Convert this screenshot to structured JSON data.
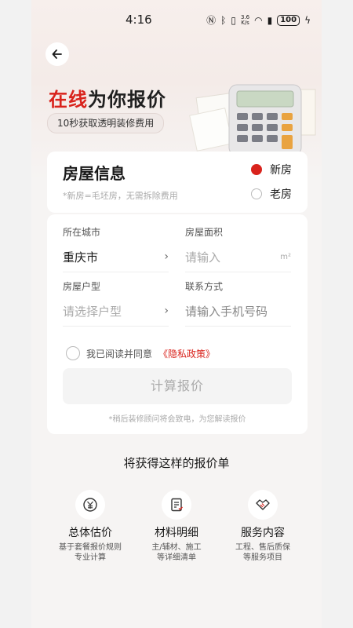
{
  "status_bar": {
    "time": "4:16",
    "speed": "3.6\nK/s",
    "battery": "100"
  },
  "hero": {
    "title_red": "在线",
    "title_rest": "为你报价",
    "subtitle": "10秒获取透明装修费用"
  },
  "house_info": {
    "title": "房屋信息",
    "note": "*新房=毛坯房，无需拆除费用",
    "options": [
      {
        "label": "新房",
        "selected": true
      },
      {
        "label": "老房",
        "selected": false
      }
    ]
  },
  "form": {
    "city": {
      "label": "所在城市",
      "value": "重庆市"
    },
    "area": {
      "label": "房屋面积",
      "placeholder": "请输入",
      "unit": "m²"
    },
    "layout": {
      "label": "房屋户型",
      "placeholder": "请选择户型"
    },
    "contact": {
      "label": "联系方式",
      "placeholder": "请输入手机号码"
    },
    "agree_text": "我已阅读并同意",
    "privacy_link": "《隐私政策》",
    "submit_label": "计算报价",
    "submit_hint": "*稍后装修顾问将会致电，为您解读报价"
  },
  "features": {
    "title": "将获得这样的报价单",
    "items": [
      {
        "icon": "yuan-icon",
        "title": "总体估价",
        "desc1": "基于套餐报价规则",
        "desc2": "专业计算"
      },
      {
        "icon": "list-icon",
        "title": "材料明细",
        "desc1": "主/辅材、施工",
        "desc2": "等详细清单"
      },
      {
        "icon": "handshake-icon",
        "title": "服务内容",
        "desc1": "工程、售后质保",
        "desc2": "等服务项目"
      }
    ]
  },
  "colors": {
    "accent": "#d9231c"
  }
}
